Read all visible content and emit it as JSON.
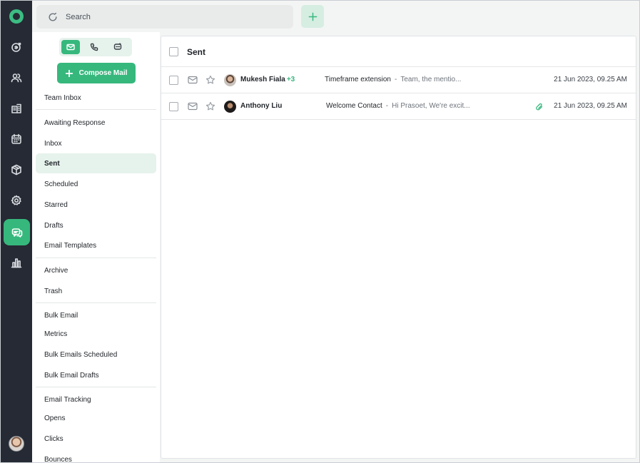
{
  "search": {
    "placeholder": "Search"
  },
  "rail": {
    "items": [
      {
        "name": "deals-icon"
      },
      {
        "name": "contacts-icon"
      },
      {
        "name": "companies-icon"
      },
      {
        "name": "calendar-icon"
      },
      {
        "name": "products-icon"
      },
      {
        "name": "settings-icon"
      },
      {
        "name": "messages-icon",
        "active": true
      },
      {
        "name": "reports-icon"
      }
    ]
  },
  "sidebar": {
    "compose_label": "Compose Mail",
    "modes": [
      "mail-icon",
      "phone-icon",
      "chat-icon"
    ],
    "items": [
      {
        "label": "Team Inbox"
      },
      {
        "label": "Awaiting Response"
      },
      {
        "label": "Inbox"
      },
      {
        "label": "Sent",
        "active": true
      },
      {
        "label": "Scheduled"
      },
      {
        "label": "Starred"
      },
      {
        "label": "Drafts"
      },
      {
        "label": "Email Templates"
      },
      {
        "label": "Archive"
      },
      {
        "label": "Trash"
      },
      {
        "label": "Bulk Email"
      },
      {
        "label": "Metrics"
      },
      {
        "label": "Bulk Emails Scheduled"
      },
      {
        "label": "Bulk Email Drafts"
      },
      {
        "label": "Email Tracking"
      },
      {
        "label": "Opens"
      },
      {
        "label": "Clicks"
      },
      {
        "label": "Bounces"
      }
    ]
  },
  "main": {
    "title": "Sent",
    "rows": [
      {
        "sender": "Mukesh Fiala",
        "extra": "+3",
        "subject": "Timeframe extension",
        "separator": "-",
        "snippet": "Team, the mentio...",
        "date": "21 Jun 2023, 09.25 AM",
        "attachment": false
      },
      {
        "sender": "Anthony Liu",
        "extra": "",
        "subject": "Welcome Contact",
        "separator": "-",
        "snippet": "Hi Prasoet, We're excit...",
        "date": "21 Jun 2023, 09.25 AM",
        "attachment": true
      }
    ]
  },
  "colors": {
    "accent": "#36b87d",
    "rail": "#262a34",
    "accent_soft": "#e6f2ec"
  }
}
